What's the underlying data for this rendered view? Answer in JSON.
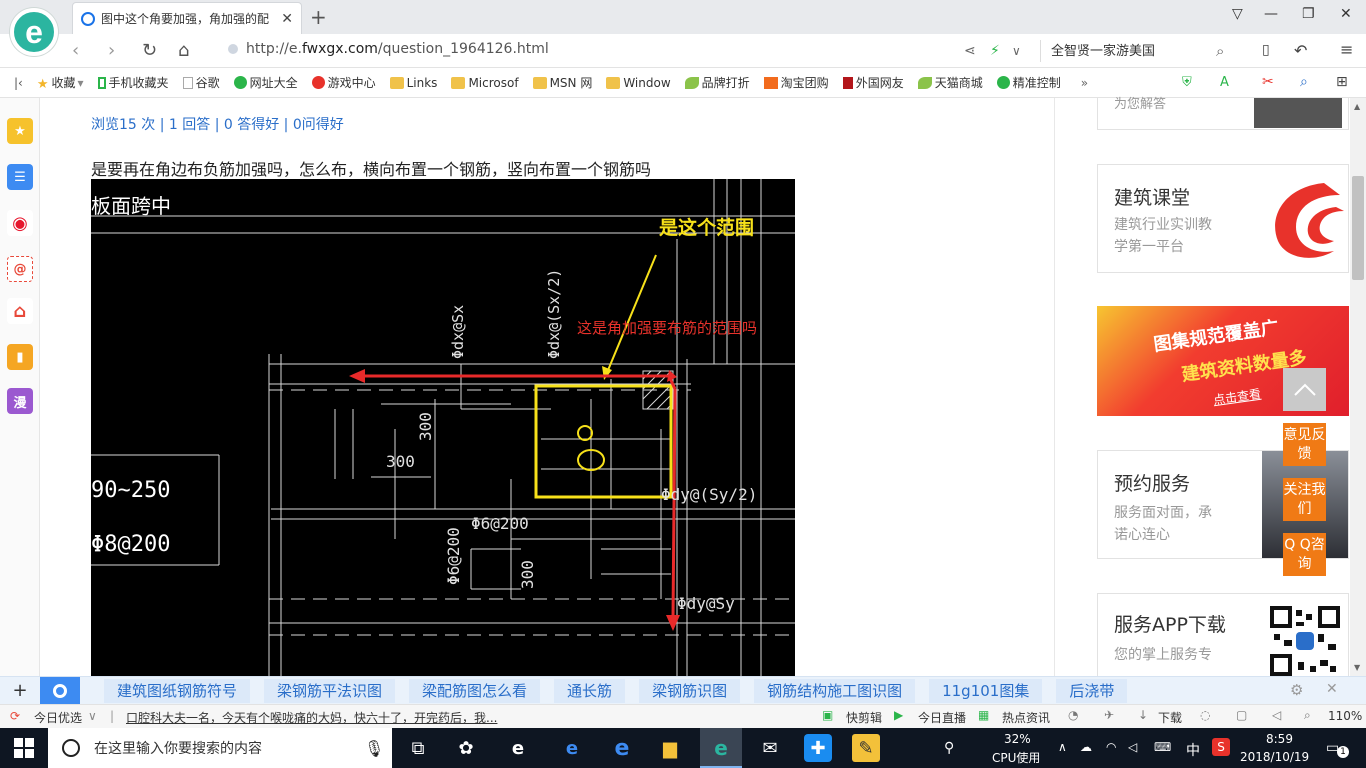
{
  "browser": {
    "tab_title": "图中这个角要加强，角加强的配",
    "url_prefix": "http://e.",
    "url_domain": "fwxgx.com",
    "url_path": "/question_1964126.html",
    "search_text": "全智贤一家游美国"
  },
  "bookmarks": [
    {
      "label": "收藏",
      "icon": "star-icon"
    },
    {
      "label": "手机收藏夹",
      "icon": "phone-icon"
    },
    {
      "label": "谷歌",
      "icon": "page-icon"
    },
    {
      "label": "网址大全",
      "icon": "globe-icon"
    },
    {
      "label": "游戏中心",
      "icon": "game-icon"
    },
    {
      "label": "Links",
      "icon": "folder-icon"
    },
    {
      "label": "Microsof",
      "icon": "folder-icon"
    },
    {
      "label": "MSN 网",
      "icon": "folder-icon"
    },
    {
      "label": "Window",
      "icon": "folder-icon"
    },
    {
      "label": "品牌打折",
      "icon": "leaf-icon"
    },
    {
      "label": "淘宝团购",
      "icon": "taobao-icon"
    },
    {
      "label": "外国网友",
      "icon": "flag-icon"
    },
    {
      "label": "天猫商城",
      "icon": "leaf-icon"
    },
    {
      "label": "精准控制",
      "icon": "chat-icon"
    }
  ],
  "sidebar": {
    "items": [
      {
        "icon": "favorites-star-icon",
        "color": "#f6c22c"
      },
      {
        "icon": "news-icon",
        "color": "#3d8bf2"
      },
      {
        "icon": "weibo-icon",
        "color": "#e6162d"
      },
      {
        "icon": "mail-icon",
        "color": "#e8493a"
      },
      {
        "icon": "game-controller-icon",
        "color": "#e8493a"
      },
      {
        "icon": "notebook-icon",
        "color": "#f5a623"
      },
      {
        "icon": "comic-icon",
        "color": "#9b59d0",
        "label": "漫"
      }
    ]
  },
  "question": {
    "stats": "浏览15 次 | 1 回答 | 0 答得好 | 0问得好",
    "text": "是要再在角边布负筋加强吗，怎么布，横向布置一个钢筋，竖向布置一个钢筋吗"
  },
  "drawing": {
    "annotation_yellow": "是这个范围",
    "annotation_red": "这是角加强要布筋的范围吗",
    "label_topleft": "板面跨中",
    "label_sx": "Φdx@Sx",
    "label_sx2": "Φdx@(Sx/2)",
    "label_300a": "300",
    "label_300b": "300",
    "label_300c": "300",
    "label_dims": "90~250",
    "label_phi8": "Φ8@200",
    "label_phi6a": "Φ6@200",
    "label_phi6b": "Φ6@200",
    "label_sy2": "Φdy@(Sy/2)",
    "label_sy": "Φdy@Sy"
  },
  "right": {
    "top_partial": "为您解答",
    "course_title": "建筑课堂",
    "course_desc1": "建筑行业实训教",
    "course_desc2": "学第一平台",
    "banner_line1": "图集规范覆盖广",
    "banner_line2": "建筑资料数量多",
    "banner_link": "点击查看",
    "booking_title": "预约服务",
    "booking_desc1": "服务面对面，承",
    "booking_desc2": "诺心连心",
    "app_title": "服务APP下载",
    "app_desc": "您的掌上服务专"
  },
  "floats": {
    "feedback": "意见反馈",
    "follow": "关注我们",
    "qq": "Q Q咨询"
  },
  "related": [
    "建筑图纸钢筋符号",
    "梁钢筋平法识图",
    "梁配筋图怎么看",
    "通长筋",
    "梁钢筋识图",
    "钢筋结构施工图识图",
    "11g101图集",
    "后浇带"
  ],
  "statusbar": {
    "today_pick": "今日优选",
    "news": "口腔科大夫一名，今天有个喉咙痛的大妈，快六十了，开完药后，我...",
    "quick_cut": "快剪辑",
    "live": "今日直播",
    "hot": "热点资讯",
    "download": "下载",
    "zoom": "110%"
  },
  "taskbar": {
    "search_placeholder": "在这里输入你要搜索的内容",
    "cpu_percent": "32%",
    "cpu_label": "CPU使用",
    "ime": "中",
    "time": "8:59",
    "date": "2018/10/19",
    "notifications": "1"
  }
}
